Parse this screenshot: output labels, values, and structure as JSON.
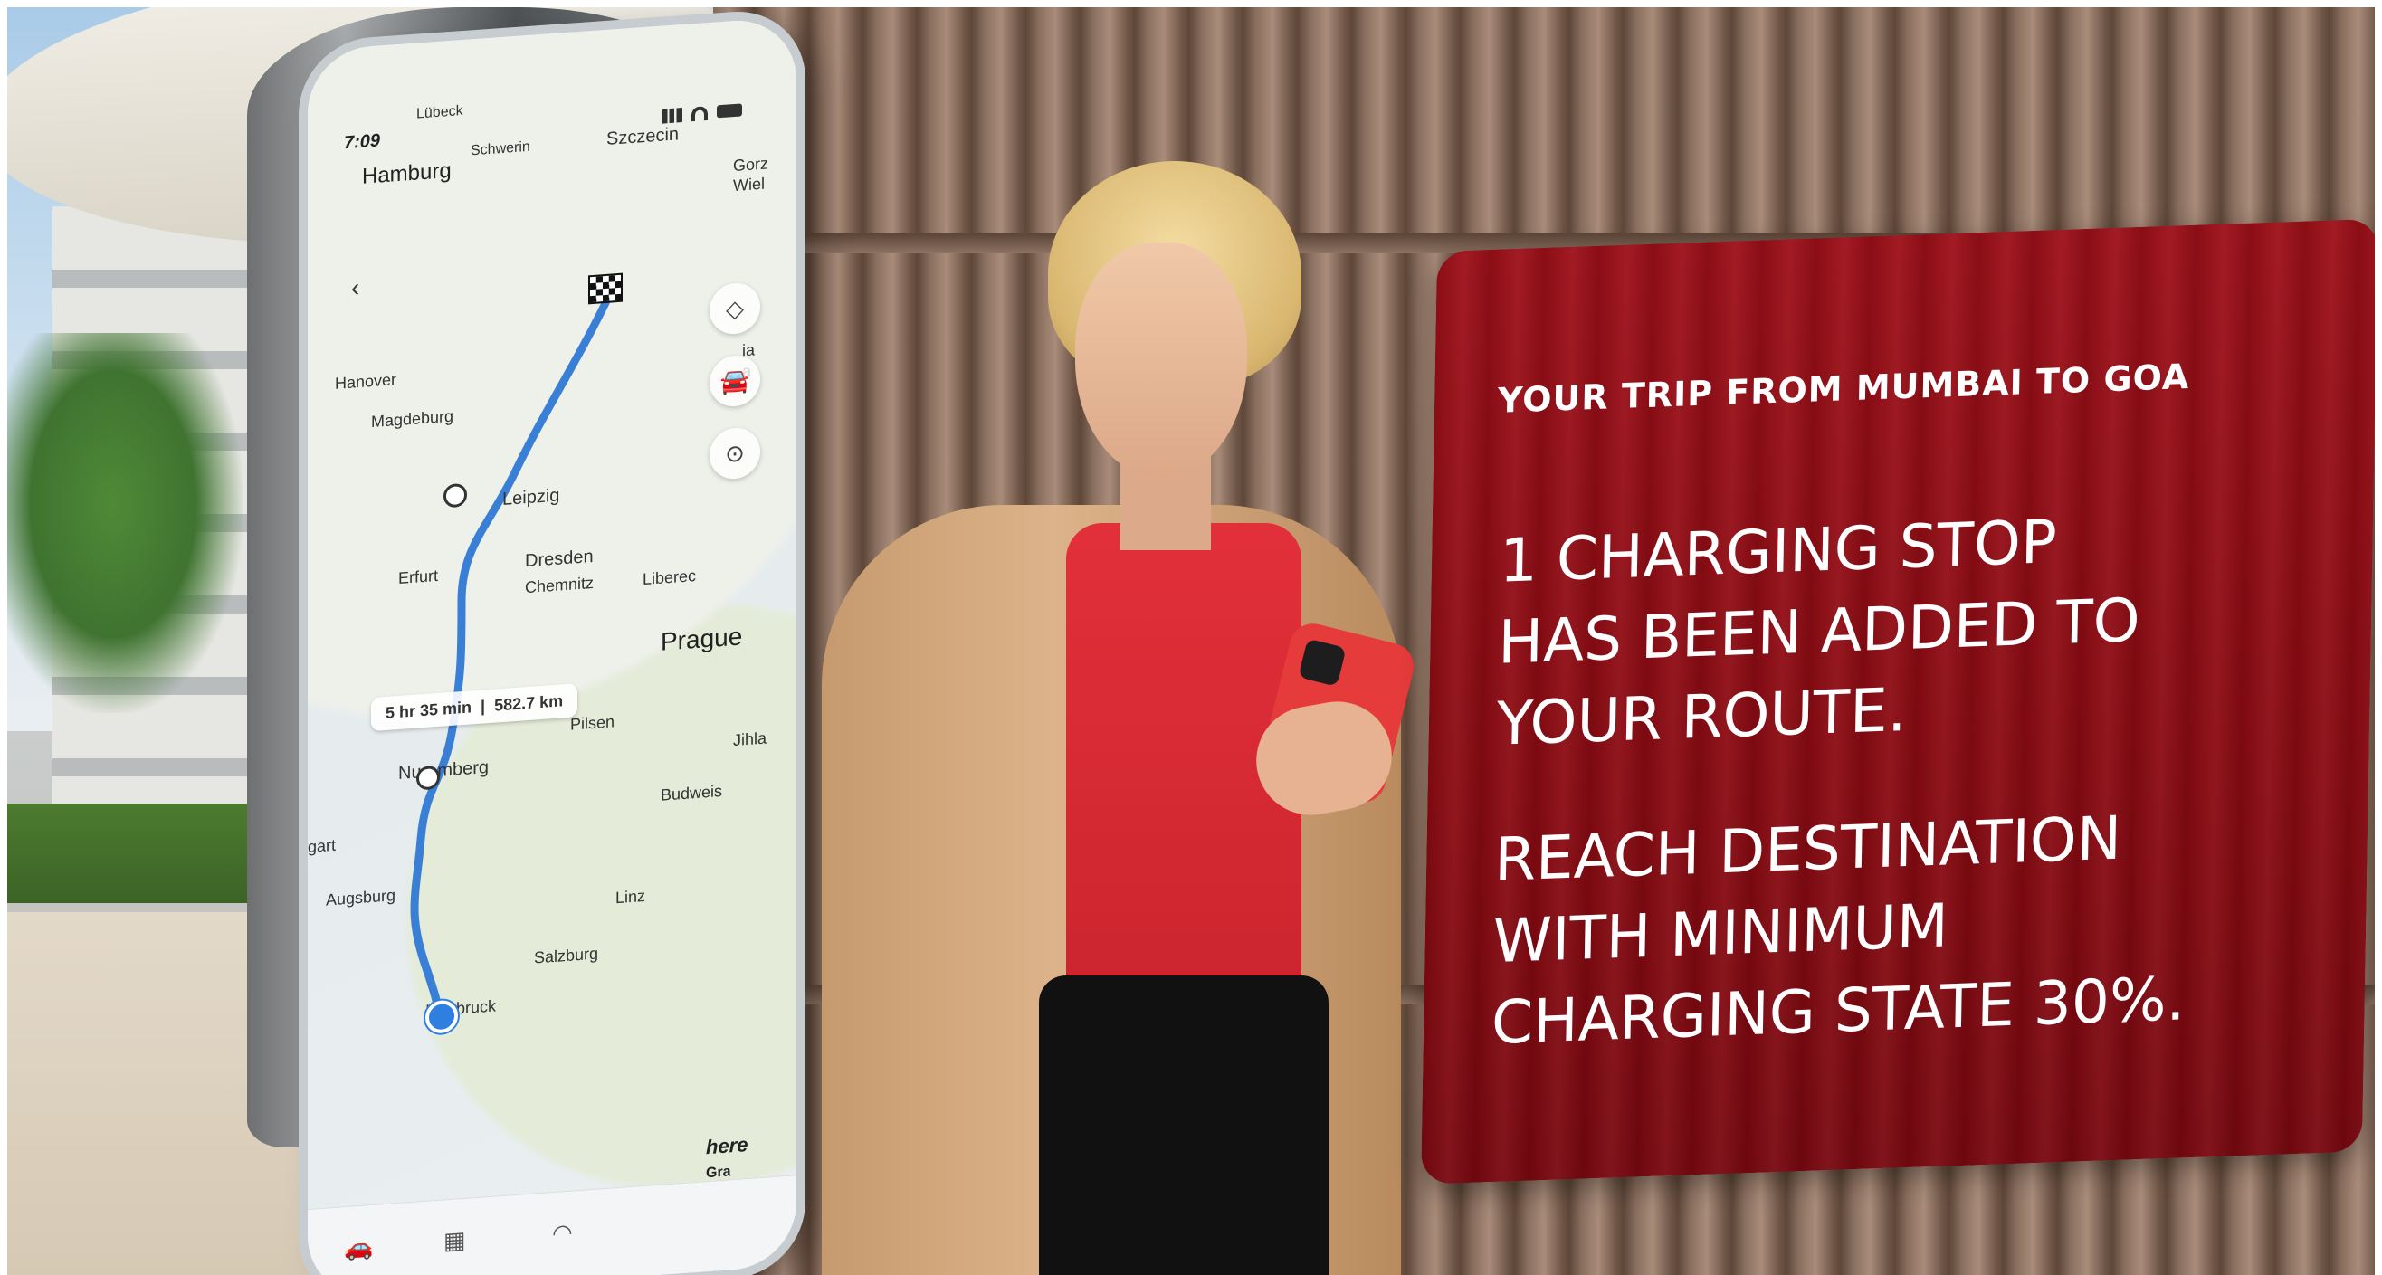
{
  "phone": {
    "status_time": "7:09",
    "map_labels": {
      "lubeck": "Lübeck",
      "hamburg": "Hamburg",
      "schwerin": "Schwerin",
      "szczecin": "Szczecin",
      "gorzow": "Gorz",
      "wiel": "Wiel",
      "hanover": "Hanover",
      "magdeburg": "Magdeburg",
      "leipzig": "Leipzig",
      "erfurt": "Erfurt",
      "dresden": "Dresden",
      "chemnitz": "Chemnitz",
      "liberec": "Liberec",
      "prague": "Prague",
      "pilsen": "Pilsen",
      "nuremberg": "Nuremberg",
      "jihla": "Jihla",
      "budweis": "Budweis",
      "gart": "gart",
      "augsburg": "Augsburg",
      "linz": "Linz",
      "salzburg": "Salzburg",
      "innsbruck": "Innsbruck",
      "ia": "ia",
      "a": "a"
    },
    "route_info": {
      "duration": "5 hr 35 min",
      "separator": "|",
      "distance": "582.7 km"
    },
    "logo": "here",
    "logo_tail": "Gra",
    "icons": {
      "back": "back-arrow-icon",
      "layers": "layers-icon",
      "car": "car-icon",
      "recenter": "recenter-icon",
      "destination": "checkered-flag-icon"
    }
  },
  "card": {
    "title": "YOUR TRIP FROM MUMBAI TO GOA",
    "message_lines": [
      "1 CHARGING STOP",
      "HAS BEEN ADDED TO",
      "YOUR ROUTE."
    ],
    "destination_lines": [
      "REACH DESTINATION",
      "WITH MINIMUM",
      "CHARGING STATE 30%."
    ]
  },
  "colors": {
    "card_red": "#8a0a12",
    "route_blue": "#3a7fd6",
    "phone_case_red": "#e53b3b"
  }
}
